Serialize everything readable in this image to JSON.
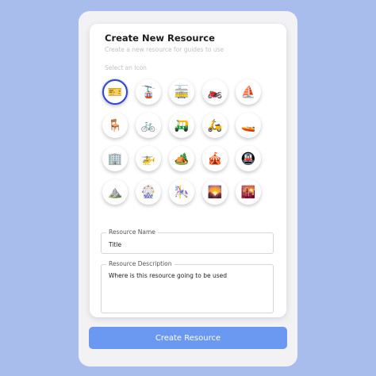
{
  "form": {
    "title": "Create New Resource",
    "subtitle": "Create a new resource for guides to use",
    "icon_label": "Select an Icon",
    "icons": [
      {
        "name": "ticket-icon",
        "glyph": "🎫",
        "selected": true
      },
      {
        "name": "cable-car-icon",
        "glyph": "🚡",
        "selected": false
      },
      {
        "name": "tram-icon",
        "glyph": "🚋",
        "selected": false
      },
      {
        "name": "motorcycle-icon",
        "glyph": "🏍️",
        "selected": false
      },
      {
        "name": "sailboat-icon",
        "glyph": "⛵",
        "selected": false
      },
      {
        "name": "chair-icon",
        "glyph": "🪑",
        "selected": false
      },
      {
        "name": "bicycle-icon",
        "glyph": "🚲",
        "selected": false
      },
      {
        "name": "auto-rickshaw-icon",
        "glyph": "🛺",
        "selected": false
      },
      {
        "name": "scooter-icon",
        "glyph": "🛵",
        "selected": false
      },
      {
        "name": "speedboat-icon",
        "glyph": "🚤",
        "selected": false
      },
      {
        "name": "building-icon",
        "glyph": "🏢",
        "selected": false
      },
      {
        "name": "helicopter-icon",
        "glyph": "🚁",
        "selected": false
      },
      {
        "name": "camping-icon",
        "glyph": "🏕️",
        "selected": false
      },
      {
        "name": "circus-tent-icon",
        "glyph": "🎪",
        "selected": false
      },
      {
        "name": "subway-icon",
        "glyph": "🚇",
        "selected": false
      },
      {
        "name": "mountain-icon",
        "glyph": "⛰️",
        "selected": false
      },
      {
        "name": "ferris-wheel-icon",
        "glyph": "🎡",
        "selected": false
      },
      {
        "name": "carousel-horse-icon",
        "glyph": "🎠",
        "selected": false
      },
      {
        "name": "sunrise-mountains-icon",
        "glyph": "🌄",
        "selected": false
      },
      {
        "name": "city-sunset-icon",
        "glyph": "🌇",
        "selected": false
      }
    ],
    "name_field": {
      "label": "Resource Name",
      "value": "Title"
    },
    "description_field": {
      "label": "Resource Description",
      "value": "Where is this resource going to be used"
    },
    "submit_label": "Create Resource"
  },
  "colors": {
    "background": "#a9bdec",
    "accent_button": "#6b98f0",
    "selected_ring": "#3347c6"
  }
}
